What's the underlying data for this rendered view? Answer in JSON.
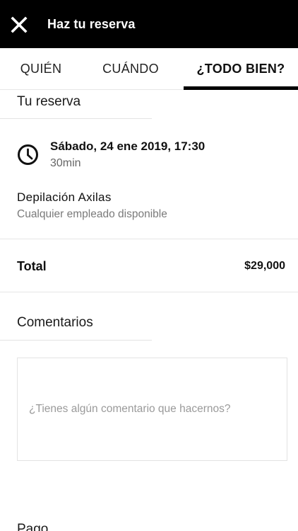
{
  "appbar": {
    "title": "Haz tu reserva"
  },
  "tabs": [
    {
      "label": "QUIÉN"
    },
    {
      "label": "CUÁNDO"
    },
    {
      "label": "¿TODO BIEN?"
    }
  ],
  "reserva": {
    "section_title": "Tu reserva",
    "date": "Sábado, 24 ene 2019, 17:30",
    "duration": "30min",
    "service": "Depilación Axilas",
    "staff": "Cualquier empleado disponible"
  },
  "total": {
    "label": "Total",
    "value": "$29,000"
  },
  "comments": {
    "section_title": "Comentarios",
    "placeholder": "¿Tienes algún comentario que hacernos?"
  },
  "payment": {
    "section_title": "Pago"
  },
  "icons": {
    "close": "close-icon",
    "clock": "clock-icon"
  },
  "colors": {
    "appbar_bg": "#000000",
    "indicator": "#000000"
  }
}
